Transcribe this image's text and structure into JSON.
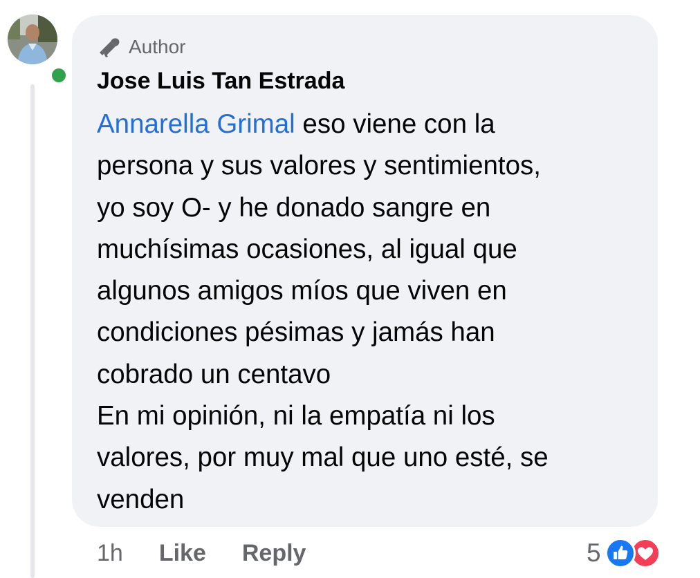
{
  "comment": {
    "badge_label": "Author",
    "badge_icon": "megaphone-icon",
    "author_name": "Jose Luis Tan Estrada",
    "mention": "Annarella Grimal",
    "text_lines": [
      " eso viene con la",
      "persona y sus valores y sentimientos,",
      "yo soy O- y he donado sangre en",
      "muchísimas ocasiones, al igual que",
      "algunos amigos míos que viven en",
      "condiciones pésimas y jamás han",
      "cobrado un centavo",
      "En mi opinión, ni la empatía ni los",
      "valores, por muy mal que uno esté, se",
      "venden"
    ],
    "online": true
  },
  "actions": {
    "timestamp": "1h",
    "like_label": "Like",
    "reply_label": "Reply"
  },
  "reactions": {
    "count": "5",
    "types": [
      "like-icon",
      "love-icon"
    ]
  },
  "colors": {
    "bubble": "#f0f2f5",
    "mention": "#216fdb",
    "secondary_text": "#65676b",
    "like_blue": "#1877f2",
    "love_red": "#f33e58",
    "online_green": "#31a24c"
  }
}
